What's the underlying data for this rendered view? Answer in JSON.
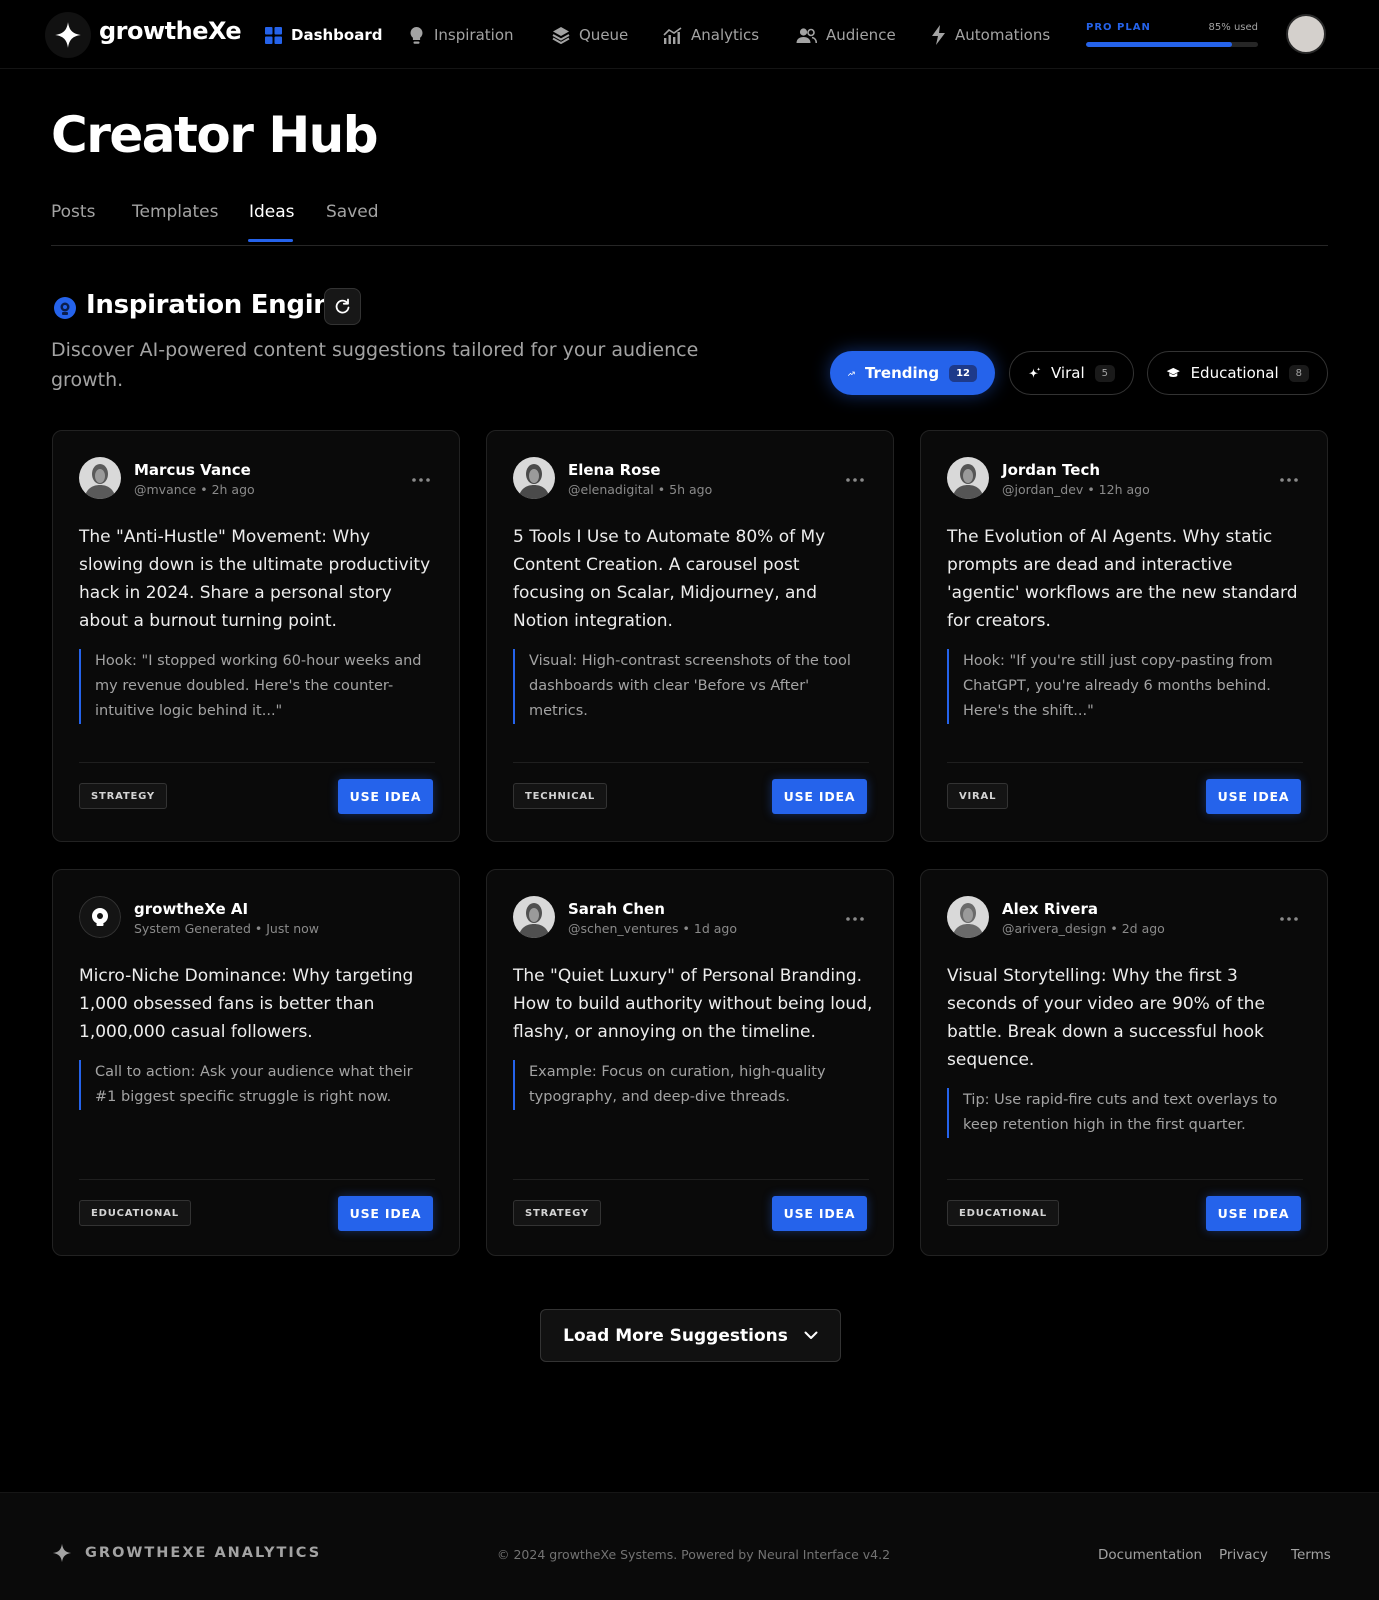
{
  "app": {
    "brand": "growtheXe",
    "nav": [
      {
        "label": "Dashboard",
        "icon": "dashboard-grid-icon",
        "active": true
      },
      {
        "label": "Inspiration",
        "icon": "lightbulb-icon"
      },
      {
        "label": "Queue",
        "icon": "layers-icon"
      },
      {
        "label": "Analytics",
        "icon": "bar-chart-icon"
      },
      {
        "label": "Audience",
        "icon": "users-icon"
      },
      {
        "label": "Automations",
        "icon": "lightning-icon"
      }
    ],
    "plan": {
      "label": "PRO PLAN",
      "used_text": "85% used",
      "used_fraction": 0.85
    }
  },
  "page": {
    "title": "Creator Hub",
    "tabs": [
      {
        "label": "Posts"
      },
      {
        "label": "Templates"
      },
      {
        "label": "Ideas",
        "active": true
      },
      {
        "label": "Saved"
      }
    ]
  },
  "section": {
    "title": "Inspiration Engine",
    "description": "Discover AI-powered content suggestions tailored for your audience growth.",
    "filters": [
      {
        "label": "Trending",
        "count": "12",
        "icon": "trending-up-icon",
        "active": true
      },
      {
        "label": "Viral",
        "count": "5",
        "icon": "sparkles-icon"
      },
      {
        "label": "Educational",
        "count": "8",
        "icon": "graduation-cap-icon"
      }
    ]
  },
  "cards": [
    {
      "name": "Marcus Vance",
      "handle": "@mvance",
      "time": "2h ago",
      "body": "The \"Anti-Hustle\" Movement: Why slowing down is the ultimate productivity hack in 2024. Share a personal story about a burnout turning point.",
      "quote": "Hook: \"I stopped working 60-hour weeks and my revenue doubled. Here's the counter-intuitive logic behind it...\"",
      "tag": "STRATEGY",
      "button": "USE IDEA"
    },
    {
      "name": "Elena Rose",
      "handle": "@elenadigital",
      "time": "5h ago",
      "body": "5 Tools I Use to Automate 80% of My Content Creation. A carousel post focusing on Scalar, Midjourney, and Notion integration.",
      "quote": "Visual: High-contrast screenshots of the tool dashboards with clear 'Before vs After' metrics.",
      "tag": "TECHNICAL",
      "button": "USE IDEA"
    },
    {
      "name": "Jordan Tech",
      "handle": "@jordan_dev",
      "time": "12h ago",
      "body": "The Evolution of AI Agents. Why static prompts are dead and interactive 'agentic' workflows are the new standard for creators.",
      "quote": "Hook: \"If you're still just copy-pasting from ChatGPT, you're already 6 months behind. Here's the shift...\"",
      "tag": "VIRAL",
      "button": "USE IDEA"
    },
    {
      "name": "growtheXe AI",
      "handle": "System Generated",
      "time": "Just now",
      "body": "Micro-Niche Dominance: Why targeting 1,000 obsessed fans is better than 1,000,000 casual followers.",
      "quote": "Call to action: Ask your audience what their #1 biggest specific struggle is right now.",
      "tag": "EDUCATIONAL",
      "button": "USE IDEA"
    },
    {
      "name": "Sarah Chen",
      "handle": "@schen_ventures",
      "time": "1d ago",
      "body": "The \"Quiet Luxury\" of Personal Branding. How to build authority without being loud, flashy, or annoying on the timeline.",
      "quote": "Example: Focus on curation, high-quality typography, and deep-dive threads.",
      "tag": "STRATEGY",
      "button": "USE IDEA"
    },
    {
      "name": "Alex Rivera",
      "handle": "@arivera_design",
      "time": "2d ago",
      "body": "Visual Storytelling: Why the first 3 seconds of your video are 90% of the battle. Break down a successful hook sequence.",
      "quote": "Tip: Use rapid-fire cuts and text overlays to keep retention high in the first quarter.",
      "tag": "EDUCATIONAL",
      "button": "USE IDEA"
    }
  ],
  "load_more": "Load More Suggestions",
  "footer": {
    "brand": "GROWTHEXE ANALYTICS",
    "copyright": "© 2024 growtheXe Systems. Powered by Neural Interface v4.2",
    "links": [
      "Documentation",
      "Privacy",
      "Terms"
    ]
  },
  "colors": {
    "accent": "#2563eb",
    "background": "#000000"
  }
}
